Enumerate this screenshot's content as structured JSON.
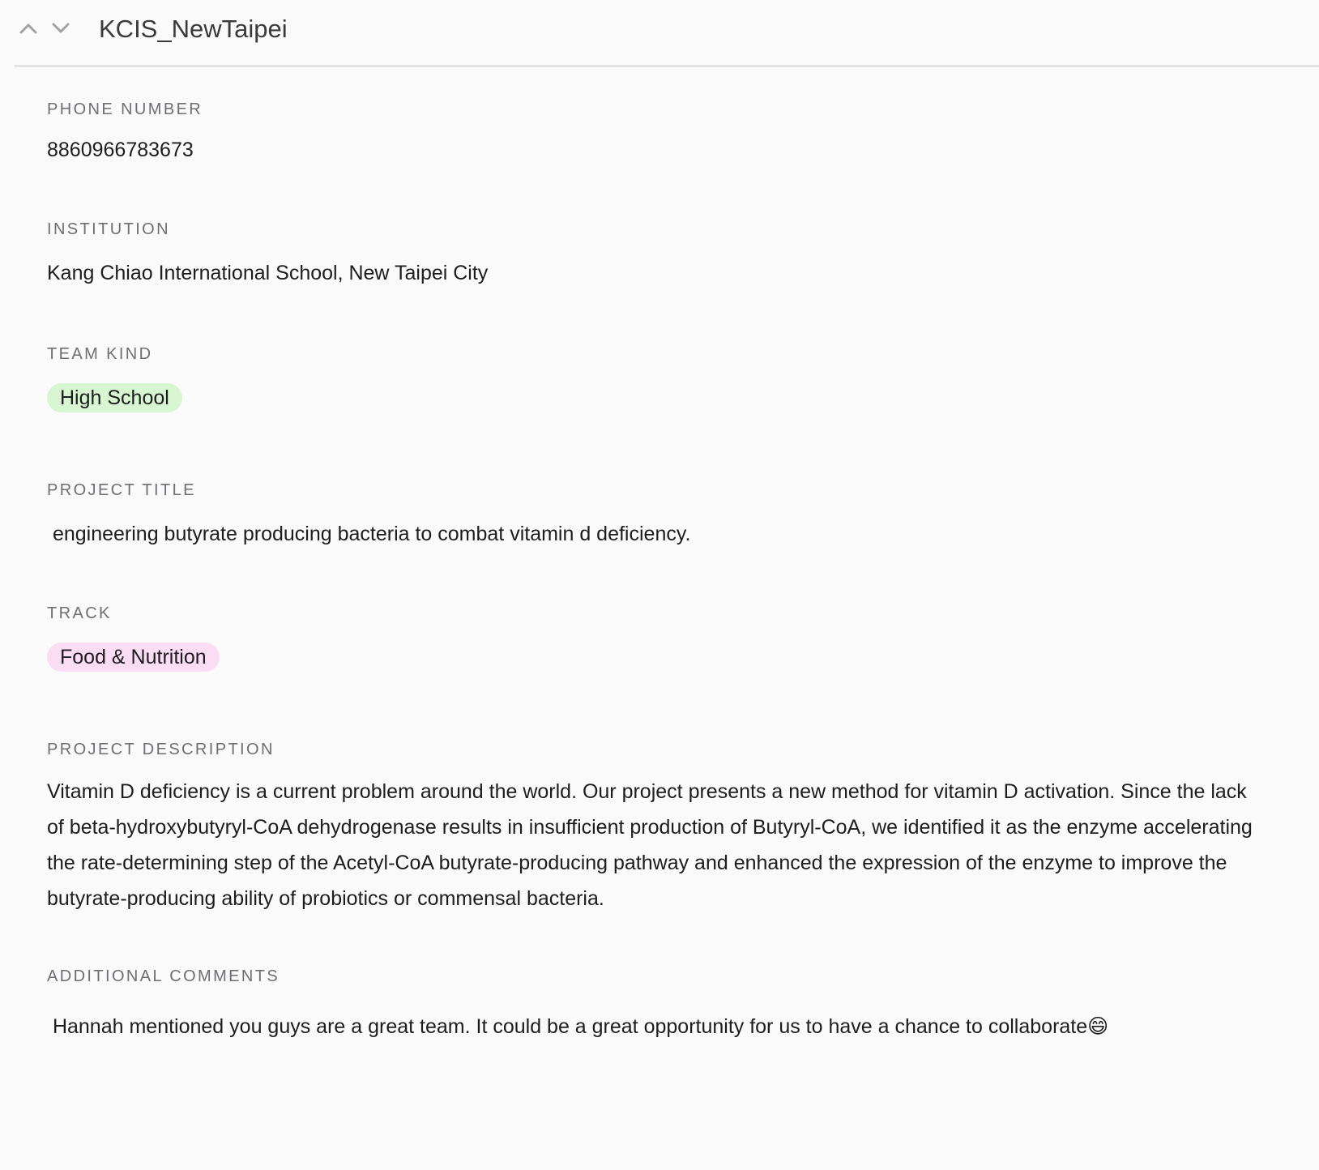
{
  "header": {
    "title": "KCIS_NewTaipei",
    "prev_icon": "chevron-up-icon",
    "next_icon": "chevron-down-icon"
  },
  "fields": {
    "phone": {
      "label": "PHONE NUMBER",
      "value": "8860966783673"
    },
    "institution": {
      "label": "INSTITUTION",
      "value": "Kang Chiao International School, New Taipei City"
    },
    "team_kind": {
      "label": "TEAM KIND",
      "value": "High School",
      "color": "#d7f5d0"
    },
    "project_title": {
      "label": "PROJECT TITLE",
      "value": " engineering butyrate producing bacteria to combat vitamin d deficiency."
    },
    "track": {
      "label": "TRACK",
      "value": "Food & Nutrition",
      "color": "#fadcf3"
    },
    "project_description": {
      "label": "PROJECT DESCRIPTION",
      "value": "Vitamin D deficiency is a current problem around the world. Our project presents a new method for vitamin D activation. Since the lack of beta-hydroxybutyryl-CoA dehydrogenase results in insufficient production of Butyryl-CoA, we identified it as the enzyme accelerating the rate-determining step of the Acetyl-CoA butyrate-producing pathway and enhanced the expression of the enzyme to improve the butyrate-producing ability of probiotics or commensal bacteria."
    },
    "additional_comments": {
      "label": "ADDITIONAL COMMENTS",
      "value": " Hannah mentioned you guys are a great team. It could be a great opportunity for us to have a chance to collaborate😄"
    }
  }
}
